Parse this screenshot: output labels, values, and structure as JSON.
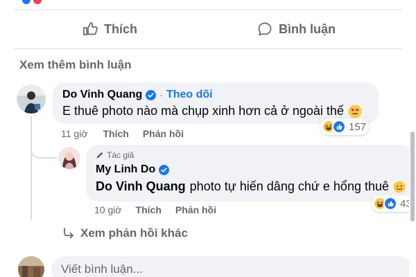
{
  "action_bar": {
    "like_label": "Thích",
    "comment_label": "Bình luận"
  },
  "more_comments_label": "Xem thêm bình luận",
  "comments": [
    {
      "author": "Do Vinh Quang",
      "verified": true,
      "separator": "·",
      "follow_label": "Theo dõi",
      "text": "E thuê photo nào mà chụp xinh hơn cả ở ngoài thế",
      "emoji": "heart-eyes-emoji",
      "time": "11 giờ",
      "like_label": "Thích",
      "reply_label": "Phản hồi",
      "reaction_count": "157",
      "reactions": [
        "haha-icon",
        "like-icon"
      ]
    }
  ],
  "reply": {
    "badge_label": "Tác giả",
    "author": "My Linh Do",
    "verified": true,
    "mention": "Do Vinh Quang",
    "text": "photo tự hiến dâng chứ e hổng thuê",
    "emoji": "smiling-emoji",
    "time": "10 giờ",
    "like_label": "Thích",
    "reply_label": "Phản hồi",
    "reaction_count": "43",
    "reactions": [
      "haha-icon",
      "like-icon"
    ]
  },
  "more_replies_label": "Xem phản hồi khác",
  "comment_input": {
    "placeholder": "Viết bình luận..."
  },
  "colors": {
    "accent": "#1877f2",
    "secondary_text": "#65676b",
    "bubble_bg": "#f0f2f5",
    "primary_text": "#050505"
  }
}
